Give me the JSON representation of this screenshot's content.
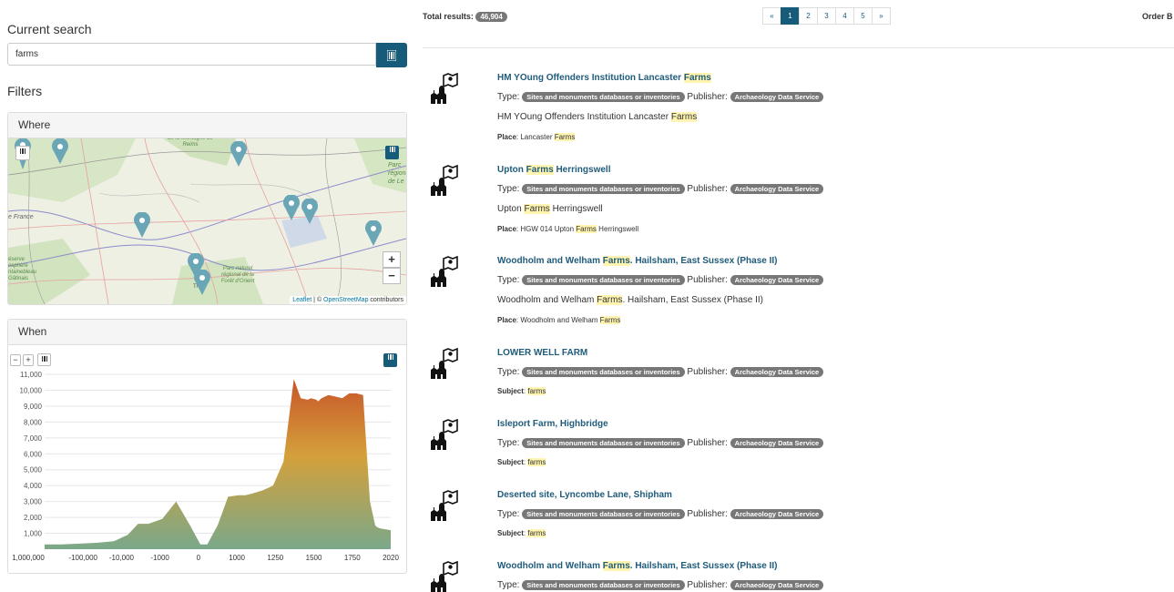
{
  "left": {
    "current_search_label": "Current search",
    "search_value": "farms",
    "filters_label": "Filters",
    "where_label": "Where",
    "when_label": "When",
    "map": {
      "place_labels": [
        "de la Montagne de Reims",
        "Parc régional de Le",
        "e France",
        "éserve osphère ntainebleau Gâtinais",
        "Parc naturel régional de la Forêt d'Orient",
        "Tr"
      ],
      "zoom_in": "+",
      "zoom_out": "−",
      "attribution_leaflet": "Leaflet",
      "attribution_sep": " | © ",
      "attribution_osm": "OpenStreetMap",
      "attribution_tail": " contributors"
    },
    "timeline": {
      "zoom_out": "−",
      "zoom_in": "+"
    }
  },
  "chart_data": {
    "type": "area",
    "title": "",
    "x_ticks": [
      "1,000,000",
      "-100,000",
      "-10,000",
      "-1000",
      "0",
      "1000",
      "1250",
      "1500",
      "1750",
      "2020"
    ],
    "y_ticks": [
      "11,000",
      "10,000",
      "9,000",
      "8,000",
      "7,000",
      "6,000",
      "5,000",
      "4,000",
      "3,000",
      "2,000",
      "1,000"
    ],
    "ylim": [
      0,
      11000
    ],
    "x_positions": [
      0,
      0.05,
      0.1,
      0.15,
      0.2,
      0.24,
      0.27,
      0.3,
      0.34,
      0.38,
      0.42,
      0.45,
      0.47,
      0.5,
      0.53,
      0.56,
      0.58,
      0.6,
      0.63,
      0.66,
      0.69,
      0.72,
      0.74,
      0.76,
      0.77,
      0.785,
      0.79,
      0.8,
      0.82,
      0.84,
      0.86,
      0.88,
      0.9,
      0.92,
      0.94,
      0.955,
      0.96,
      0.97,
      1.0
    ],
    "values": [
      300,
      300,
      350,
      400,
      500,
      900,
      1600,
      1600,
      1900,
      3000,
      1500,
      300,
      300,
      1500,
      3300,
      3400,
      3400,
      3500,
      3700,
      4000,
      5500,
      10700,
      9500,
      9400,
      9500,
      9400,
      9300,
      9500,
      9700,
      9600,
      9500,
      9800,
      9800,
      9700,
      3000,
      1500,
      1400,
      1300,
      1200
    ]
  },
  "results_header": {
    "total_label": "Total results:",
    "total_value": "46,904",
    "pages": [
      "«",
      "1",
      "2",
      "3",
      "4",
      "5",
      "»"
    ],
    "active_page": "1",
    "order_label": "Order B"
  },
  "results": [
    {
      "title_parts": [
        "HM YOung Offenders Institution Lancaster ",
        "Farms",
        ""
      ],
      "type_label": "Type:",
      "type_tag": "Sites and monuments databases or inventories",
      "publisher_label": "Publisher:",
      "publisher_tag": "Archaeology Data Service",
      "desc_parts": [
        "HM YOung Offenders Institution Lancaster ",
        "Farms",
        ""
      ],
      "field_label": "Place",
      "field_parts": [
        ": Lancaster ",
        "Farms",
        ""
      ]
    },
    {
      "title_parts": [
        "Upton ",
        "Farms",
        " Herringswell"
      ],
      "type_label": "Type:",
      "type_tag": "Sites and monuments databases or inventories",
      "publisher_label": "Publisher:",
      "publisher_tag": "Archaeology Data Service",
      "desc_parts": [
        "Upton ",
        "Farms",
        " Herringswell"
      ],
      "field_label": "Place",
      "field_parts": [
        ": HGW 014 Upton ",
        "Farms",
        " Herringswell"
      ]
    },
    {
      "title_parts": [
        "Woodholm and Welham ",
        "Farms",
        ". Hailsham, East Sussex (Phase II)"
      ],
      "type_label": "Type:",
      "type_tag": "Sites and monuments databases or inventories",
      "publisher_label": "Publisher:",
      "publisher_tag": "Archaeology Data Service",
      "desc_parts": [
        "Woodholm and Welham ",
        "Farms",
        ". Hailsham, East Sussex (Phase II)"
      ],
      "field_label": "Place",
      "field_parts": [
        ": Woodholm and Welham ",
        "Farms",
        ""
      ]
    },
    {
      "title_parts": [
        "LOWER WELL FARM",
        "",
        ""
      ],
      "type_label": "Type:",
      "type_tag": "Sites and monuments databases or inventories",
      "publisher_label": "Publisher:",
      "publisher_tag": "Archaeology Data Service",
      "field_label": "Subject",
      "field_parts": [
        ": ",
        "farms",
        ""
      ]
    },
    {
      "title_parts": [
        "Isleport Farm, Highbridge",
        "",
        ""
      ],
      "type_label": "Type:",
      "type_tag": "Sites and monuments databases or inventories",
      "publisher_label": "Publisher:",
      "publisher_tag": "Archaeology Data Service",
      "field_label": "Subject",
      "field_parts": [
        ": ",
        "farms",
        ""
      ]
    },
    {
      "title_parts": [
        "Deserted site, Lyncombe Lane, Shipham",
        "",
        ""
      ],
      "type_label": "Type:",
      "type_tag": "Sites and monuments databases or inventories",
      "publisher_label": "Publisher:",
      "publisher_tag": "Archaeology Data Service",
      "field_label": "Subject",
      "field_parts": [
        ": ",
        "farms",
        ""
      ]
    },
    {
      "title_parts": [
        "Woodholm and Welham ",
        "Farms",
        ". Hailsham, East Sussex (Phase II)"
      ],
      "type_label": "Type:",
      "type_tag": "Sites and monuments databases or inventories",
      "publisher_label": "Publisher:",
      "publisher_tag": "Archaeology Data Service"
    }
  ],
  "colors": {
    "primary": "#165b79",
    "title_link": "#1f5b7a",
    "badge": "#777777",
    "highlight": "#fff5b0",
    "area_top": "#c8552a",
    "area_mid": "#d4a03a",
    "area_bottom": "#7aa88a",
    "marker": "#6aa6b5"
  },
  "icons": {
    "search_button": "barcode-icon",
    "result_icon": "map-monument-icon",
    "map_layers": "barcode-icon"
  }
}
